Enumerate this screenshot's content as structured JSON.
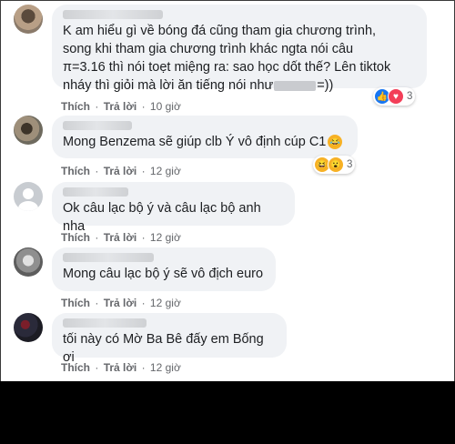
{
  "actions": {
    "like": "Thích",
    "reply": "Trả lời",
    "separator": "·"
  },
  "comments": [
    {
      "text": "K am hiểu gì về bóng đá cũng tham gia chương trình,\nsong khi tham gia chương trình khác ngta nói câu\nπ=3.16 thì nói toẹt miệng ra: sao học dốt thế? Lên tiktok\nnháy thì giỏi mà lời ăn tiếng nói như",
      "text_tail": "=))",
      "time": "10 giờ",
      "reaction_count": "3",
      "reaction_icons": [
        "like-icon",
        "love-icon"
      ]
    },
    {
      "text": "Mong Benzema sẽ giúp clb Ý vô định cúp C1",
      "time": "12 giờ",
      "reaction_count": "3",
      "reaction_icons": [
        "haha-icon",
        "wow-icon"
      ]
    },
    {
      "text": "Ok câu lạc bộ ý và câu lạc bộ anh nha",
      "time": "12 giờ"
    },
    {
      "text": "Mong câu lạc bộ ý sẽ vô địch euro",
      "time": "12 giờ"
    },
    {
      "text": "tối này có Mờ Ba Bê đấy em Bống ơi",
      "time": "12 giờ"
    }
  ],
  "colors": {
    "bubble": "#f0f2f5",
    "meta_text": "#65676b",
    "like_blue": "#1877f2",
    "love_red": "#f33e58",
    "haha_yellow": "#f7b125"
  }
}
